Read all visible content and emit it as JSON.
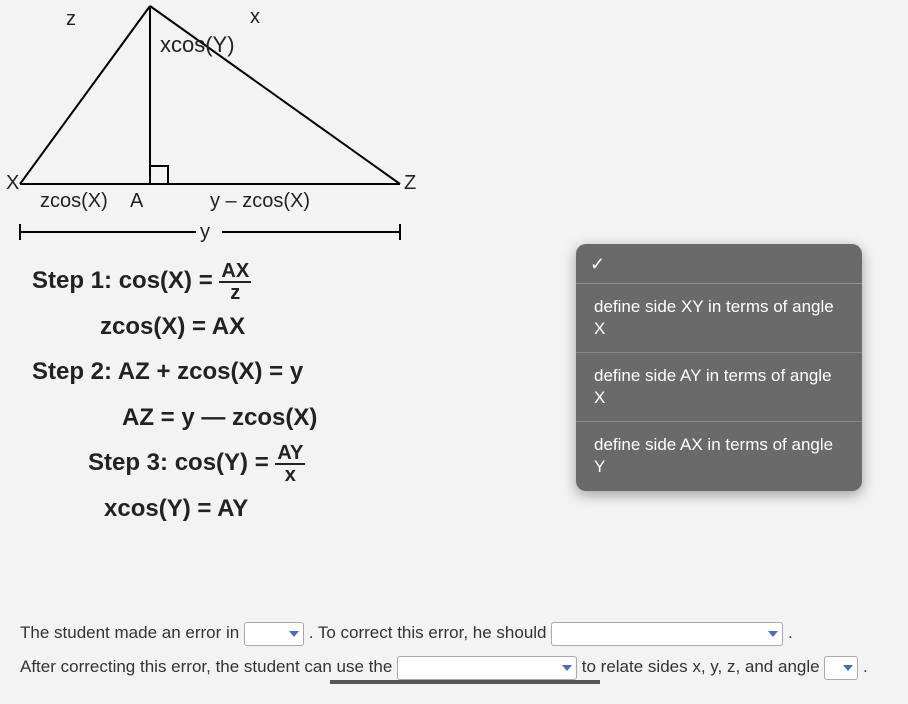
{
  "triangle": {
    "X": "X",
    "Z": "Z",
    "A": "A",
    "z_side": "z",
    "x_side": "x",
    "altitude": "xcos(Y)",
    "left_base": "zcos(X)",
    "right_base": "y – zcos(X)",
    "full_base": "y"
  },
  "steps": {
    "s1_label": "Step 1:",
    "s1_eq": "cos(X) = ",
    "s1_num": "AX",
    "s1_den": "z",
    "s1b": "zcos(X) = AX",
    "s2_label": "Step 2:",
    "s2_eq": "AZ + zcos(X) = y",
    "s2b": "AZ = y — zcos(X)",
    "s3_label": "Step 3:",
    "s3_eq": "cos(Y) = ",
    "s3_num": "AY",
    "s3_den": "x",
    "s3b": "xcos(Y) = AY"
  },
  "popup": {
    "check": "✓",
    "opt1": "define side XY in terms of angle X",
    "opt2": "define side AY in terms of angle X",
    "opt3": "define side AX in terms of angle Y"
  },
  "bottom": {
    "t1": "The student made an error in ",
    "t2": ". To correct this error, he should ",
    "t3": "After correcting this error, the student can use the ",
    "t4": " to relate sides x, y, z, and angle ",
    "period": "."
  }
}
